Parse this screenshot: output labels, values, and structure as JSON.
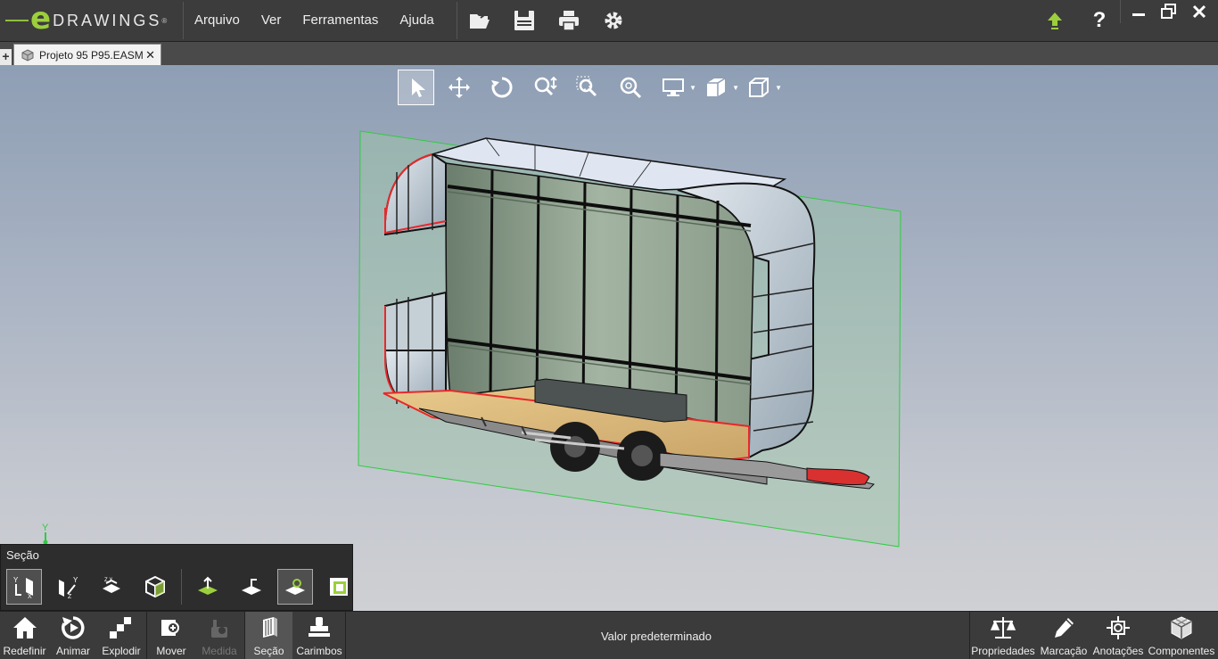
{
  "app": {
    "logo_text": "DRAWINGS",
    "logo_reg": "®",
    "logo_e": "e"
  },
  "menu": [
    "Arquivo",
    "Ver",
    "Ferramentas",
    "Ajuda"
  ],
  "toolbar_icons": [
    "open-folder-icon",
    "save-icon",
    "print-icon",
    "settings-gear-icon"
  ],
  "header_right": {
    "update_icon": "up-arrow-icon",
    "help_label": "?"
  },
  "window_controls": [
    "minimize-icon",
    "restore-icon",
    "close-icon"
  ],
  "tabs": {
    "new_tab_label": "+",
    "document_tab": {
      "label": "Projeto 95 P95.EASM",
      "close_label": "✕"
    }
  },
  "view_tools": [
    {
      "name": "select-arrow-icon",
      "selected": true
    },
    {
      "name": "pan-icon"
    },
    {
      "name": "rotate-icon"
    },
    {
      "name": "zoom-icon"
    },
    {
      "name": "zoom-area-icon"
    },
    {
      "name": "zoom-fit-icon"
    },
    {
      "name": "display-style-icon",
      "dropdown": true
    },
    {
      "name": "view-orientation-icon",
      "dropdown": true
    },
    {
      "name": "cube-view-icon",
      "dropdown": true
    }
  ],
  "section_panel": {
    "title": "Seção",
    "buttons": [
      {
        "name": "section-plane-yx-icon",
        "selected": true
      },
      {
        "name": "section-plane-zy-icon"
      },
      {
        "name": "section-plane-zx-icon"
      },
      {
        "name": "section-box-icon"
      },
      {
        "name": "flip-section-icon"
      },
      {
        "name": "section-direction-icon"
      },
      {
        "name": "section-cap-icon",
        "selected": true
      },
      {
        "name": "section-properties-icon"
      }
    ]
  },
  "triad": {
    "y_label": "Y"
  },
  "bottom_bar": {
    "left": [
      {
        "label": "Redefinir",
        "icon": "home-icon"
      },
      {
        "label": "Animar",
        "icon": "animate-icon"
      },
      {
        "label": "Explodir",
        "icon": "explode-icon"
      },
      {
        "label": "Mover",
        "icon": "move-icon"
      },
      {
        "label": "Medida",
        "icon": "measure-icon",
        "disabled": true
      },
      {
        "label": "Seção",
        "icon": "section-icon",
        "active": true
      },
      {
        "label": "Carimbos",
        "icon": "stamp-icon"
      }
    ],
    "status": "Valor predeterminado",
    "right": [
      {
        "label": "Propriedades",
        "icon": "balance-scale-icon"
      },
      {
        "label": "Marcação",
        "icon": "pencil-icon"
      },
      {
        "label": "Anotações",
        "icon": "annotation-icon"
      },
      {
        "label": "Componentes",
        "icon": "components-icon"
      }
    ]
  },
  "colors": {
    "logo_green": "#9ccf3c",
    "section_plane": "#2ecc40",
    "cut_edges": "#e8282a"
  }
}
